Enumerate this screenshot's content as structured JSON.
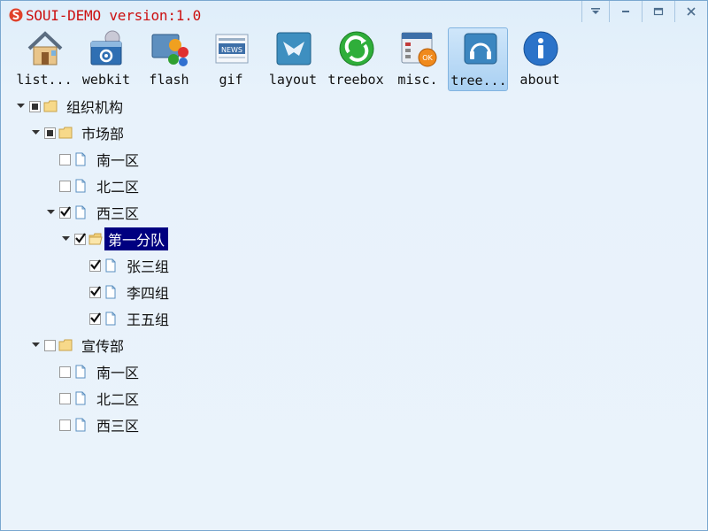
{
  "window": {
    "title": "SOUI-DEMO version:1.0",
    "controls": [
      "menu",
      "minimize",
      "maximize",
      "close"
    ]
  },
  "toolbar": {
    "items": [
      {
        "label": "list...",
        "icon": "house-icon"
      },
      {
        "label": "webkit",
        "icon": "browser-gear-icon"
      },
      {
        "label": "flash",
        "icon": "flash-apps-icon"
      },
      {
        "label": "gif",
        "icon": "news-icon"
      },
      {
        "label": "layout",
        "icon": "layout-icon"
      },
      {
        "label": "treebox",
        "icon": "green-refresh-icon"
      },
      {
        "label": "misc.",
        "icon": "calculator-icon"
      },
      {
        "label": "tree...",
        "icon": "headphones-icon",
        "selected": true
      },
      {
        "label": "about",
        "icon": "info-icon"
      }
    ]
  },
  "tree": {
    "nodes": [
      {
        "label": "组织机构",
        "check": "partial",
        "type": "folder",
        "expanded": true
      },
      {
        "label": "市场部",
        "check": "partial",
        "type": "folder",
        "expanded": true
      },
      {
        "label": "南一区",
        "check": "none",
        "type": "file"
      },
      {
        "label": "北二区",
        "check": "none",
        "type": "file"
      },
      {
        "label": "西三区",
        "check": "checked",
        "type": "file",
        "expanded": true
      },
      {
        "label": "第一分队",
        "check": "checked",
        "type": "folder",
        "expanded": true,
        "selected": true
      },
      {
        "label": "张三组",
        "check": "checked",
        "type": "file"
      },
      {
        "label": "李四组",
        "check": "checked",
        "type": "file"
      },
      {
        "label": "王五组",
        "check": "checked",
        "type": "file"
      },
      {
        "label": "宣传部",
        "check": "none",
        "type": "folder",
        "expanded": true
      },
      {
        "label": "南一区",
        "check": "none",
        "type": "file"
      },
      {
        "label": "北二区",
        "check": "none",
        "type": "file"
      },
      {
        "label": "西三区",
        "check": "none",
        "type": "file"
      }
    ]
  },
  "colors": {
    "title_text": "#cc1010",
    "selection_bg": "#000080",
    "window_bg": "#e8f2fb"
  }
}
